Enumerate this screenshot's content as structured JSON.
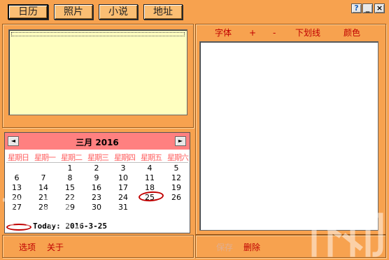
{
  "tabs": [
    {
      "label": "日历"
    },
    {
      "label": "照片"
    },
    {
      "label": "小说"
    },
    {
      "label": "地址"
    }
  ],
  "window": {
    "help": "?",
    "minimize": "_",
    "close": "×"
  },
  "toolbar": {
    "font": "字体",
    "increase": "+",
    "decrease": "-",
    "underline": "下划线",
    "color": "颜色"
  },
  "calendar": {
    "prev_label": "◄",
    "next_label": "►",
    "month_title": "三月 2016",
    "weekdays": [
      "星期日",
      "星期一",
      "星期二",
      "星期三",
      "星期四",
      "星期五",
      "星期六"
    ],
    "weeks": [
      [
        "",
        "",
        "1",
        "2",
        "3",
        "4",
        "5"
      ],
      [
        "6",
        "7",
        "8",
        "9",
        "10",
        "11",
        "12"
      ],
      [
        "13",
        "14",
        "15",
        "16",
        "17",
        "18",
        "19"
      ],
      [
        "20",
        "21",
        "22",
        "23",
        "24",
        "25",
        "26"
      ],
      [
        "27",
        "28",
        "29",
        "30",
        "31",
        "",
        ""
      ]
    ],
    "today_text": "Today: 2016-3-25"
  },
  "bottom_left": {
    "options": "选项",
    "about": "关于"
  },
  "bottom_right": {
    "save": "保存",
    "delete": "删除"
  },
  "colors": {
    "background": "#F7A24F",
    "note_bg": "#FFFFC0",
    "calendar_header": "#FF8080",
    "weekday_text": "#FF6060",
    "accent_red": "#C00000"
  }
}
